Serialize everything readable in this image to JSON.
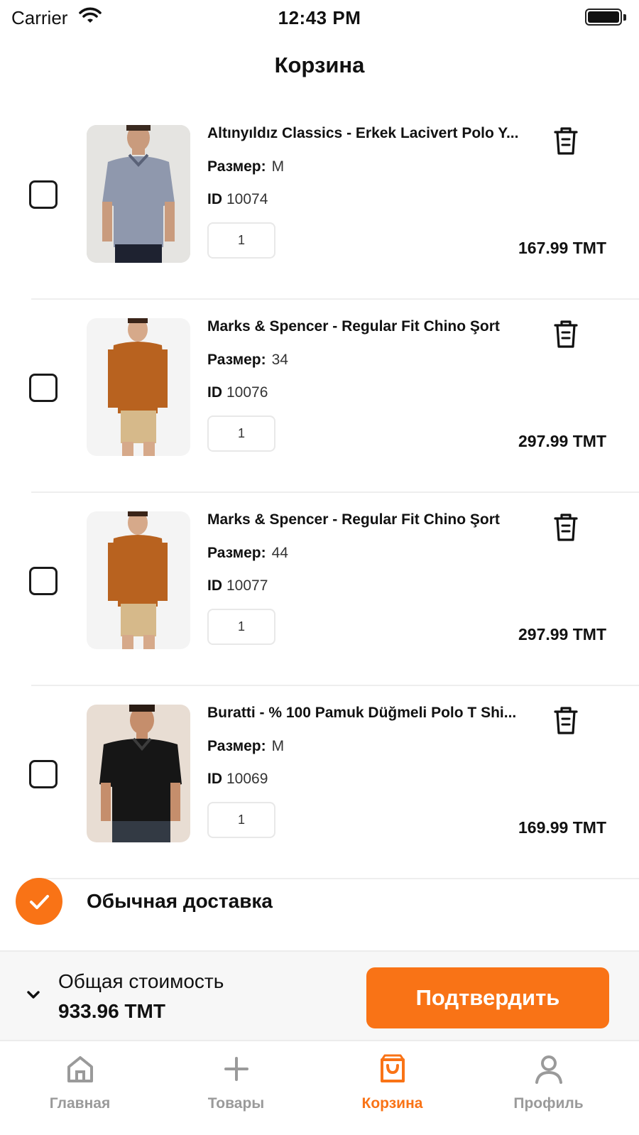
{
  "status_bar": {
    "carrier": "Carrier",
    "time": "12:43 PM"
  },
  "header": {
    "title": "Корзина"
  },
  "cart": {
    "items": [
      {
        "name": "Altınyıldız Classics - Erkek Lacivert Polo Y...",
        "size_label": "Размер:",
        "size": "M",
        "id_label": "ID",
        "id": "10074",
        "quantity": "1",
        "price": "167.99 TMT",
        "image": "man-in-blue-grey-polo-shirt",
        "checked": false
      },
      {
        "name": "Marks & Spencer - Regular Fit Chino Şort",
        "size_label": "Размер:",
        "size": "34",
        "id_label": "ID",
        "id": "10076",
        "quantity": "1",
        "price": "297.99 TMT",
        "image": "man-in-orange-sweater-and-beige-chino-shorts",
        "checked": false
      },
      {
        "name": "Marks & Spencer - Regular Fit Chino Şort",
        "size_label": "Размер:",
        "size": "44",
        "id_label": "ID",
        "id": "10077",
        "quantity": "1",
        "price": "297.99 TMT",
        "image": "man-in-orange-sweater-and-beige-chino-shorts",
        "checked": false
      },
      {
        "name": "Buratti - % 100 Pamuk Düğmeli Polo T Shi...",
        "size_label": "Размер:",
        "size": "M",
        "id_label": "ID",
        "id": "10069",
        "quantity": "1",
        "price": "169.99 TMT",
        "image": "man-in-black-polo-shirt",
        "checked": false
      }
    ]
  },
  "delivery": {
    "label": "Обычная доставка",
    "selected": true,
    "icon": "check-circle-icon"
  },
  "summary": {
    "total_label": "Общая стоимость",
    "total_value": "933.96 TMT",
    "confirm_label": "Подтвердить",
    "toggle_icon": "chevron-down-icon"
  },
  "tabbar": {
    "tabs": [
      {
        "label": "Главная",
        "icon": "home-icon",
        "active": false
      },
      {
        "label": "Товары",
        "icon": "plus-icon",
        "active": false
      },
      {
        "label": "Корзина",
        "icon": "shopping-bag-icon",
        "active": true
      },
      {
        "label": "Профиль",
        "icon": "user-icon",
        "active": false
      }
    ]
  },
  "colors": {
    "accent": "#f97316",
    "text": "#111111",
    "muted": "#9a9a9a",
    "divider": "#eeeeee"
  }
}
